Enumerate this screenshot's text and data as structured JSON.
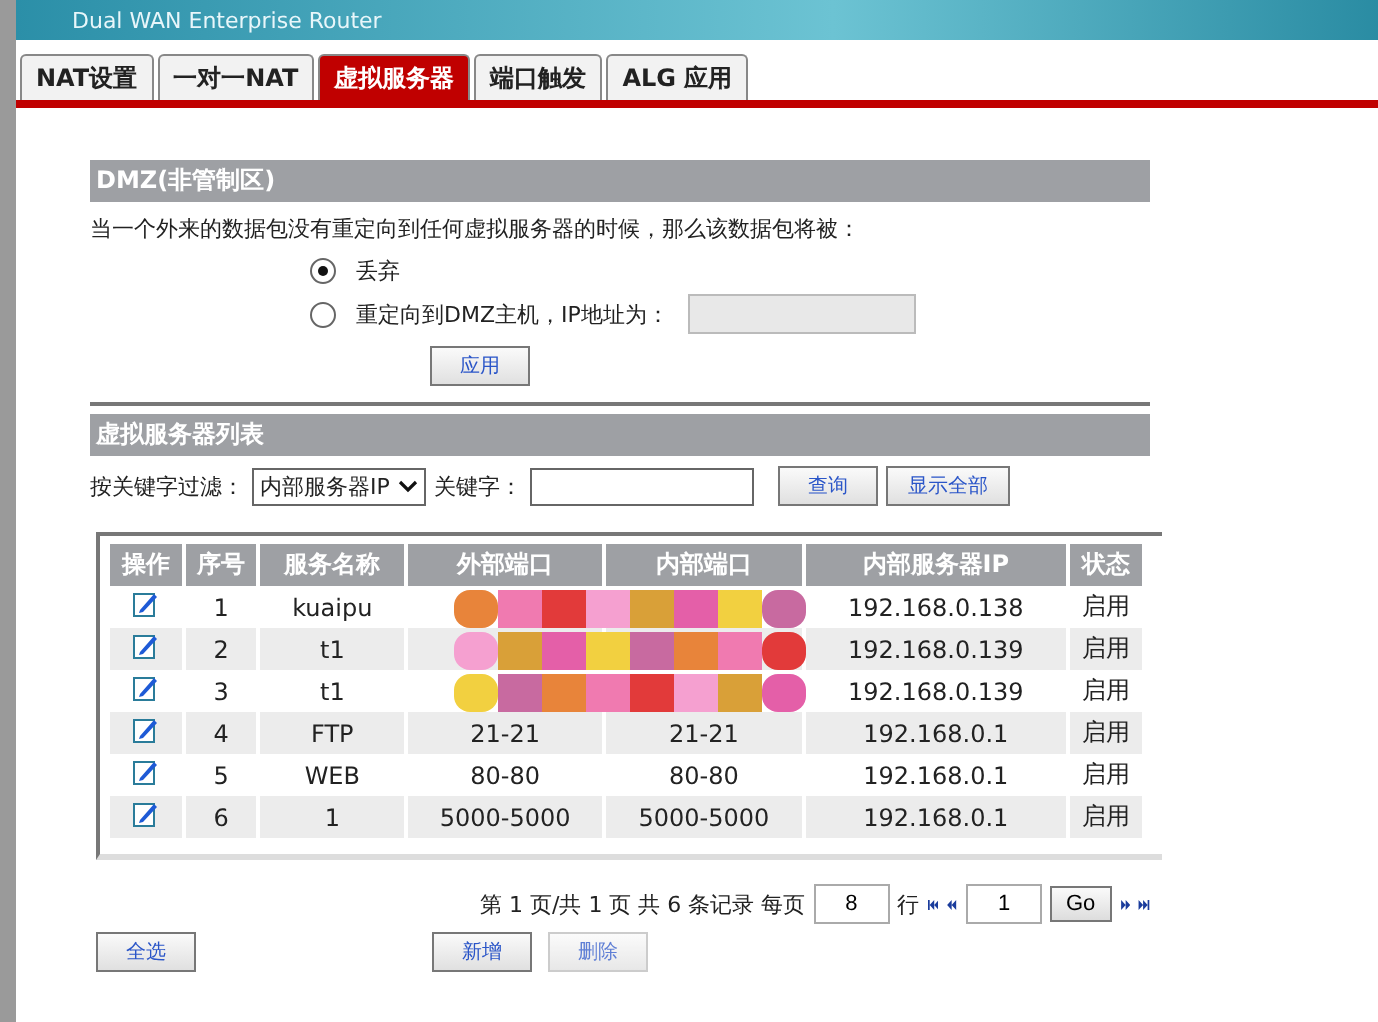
{
  "banner": {
    "title": "Dual WAN Enterprise Router"
  },
  "tabs": [
    {
      "label": "NAT设置",
      "selected": false
    },
    {
      "label": "一对一NAT",
      "selected": false
    },
    {
      "label": "虚拟服务器",
      "selected": true
    },
    {
      "label": "端口触发",
      "selected": false
    },
    {
      "label": "ALG 应用",
      "selected": false
    }
  ],
  "dmz": {
    "title": "DMZ(非管制区)",
    "description": "当一个外来的数据包没有重定向到任何虚拟服务器的时候，那么该数据包将被：",
    "options": [
      {
        "label": "丢弃",
        "selected": true,
        "has_ip_field": false
      },
      {
        "label": "重定向到DMZ主机，IP地址为：",
        "selected": false,
        "has_ip_field": true
      }
    ],
    "apply_button": "应用"
  },
  "list": {
    "title": "虚拟服务器列表",
    "filter_label": "按关键字过滤：",
    "filter_select": "内部服务器IP",
    "keyword_label": "关键字：",
    "search_button": "查询",
    "show_all_button": "显示全部",
    "columns": [
      "操作",
      "序号",
      "服务名称",
      "外部端口",
      "内部端口",
      "内部服务器IP",
      "状态"
    ],
    "rows": [
      {
        "no": "1",
        "name": "kuaipu",
        "ip": "192.168.0.138",
        "status": "启用",
        "redacted": true
      },
      {
        "no": "2",
        "name": "t1",
        "ip": "192.168.0.139",
        "status": "启用",
        "redacted": true
      },
      {
        "no": "3",
        "name": "t1",
        "ip": "192.168.0.139",
        "status": "启用",
        "redacted": true
      },
      {
        "no": "4",
        "name": "FTP",
        "ext": "21-21",
        "int": "21-21",
        "ip": "192.168.0.1",
        "status": "启用",
        "redacted": false
      },
      {
        "no": "5",
        "name": "WEB",
        "ext": "80-80",
        "int": "80-80",
        "ip": "192.168.0.1",
        "status": "启用",
        "redacted": false
      },
      {
        "no": "6",
        "name": "1",
        "ext": "5000-5000",
        "int": "5000-5000",
        "ip": "192.168.0.1",
        "status": "启用",
        "redacted": false
      }
    ]
  },
  "pager": {
    "info": "第 1 页/共 1 页 共 6 条记录 每页",
    "per_page": "8",
    "rows_label": "行",
    "page": "1",
    "go_button": "Go"
  },
  "buttons": [
    {
      "label": "全选",
      "kind": "left",
      "disabled": false
    },
    {
      "label": "新增",
      "kind": "center",
      "disabled": false
    },
    {
      "label": "删除",
      "kind": "center",
      "disabled": true
    }
  ]
}
